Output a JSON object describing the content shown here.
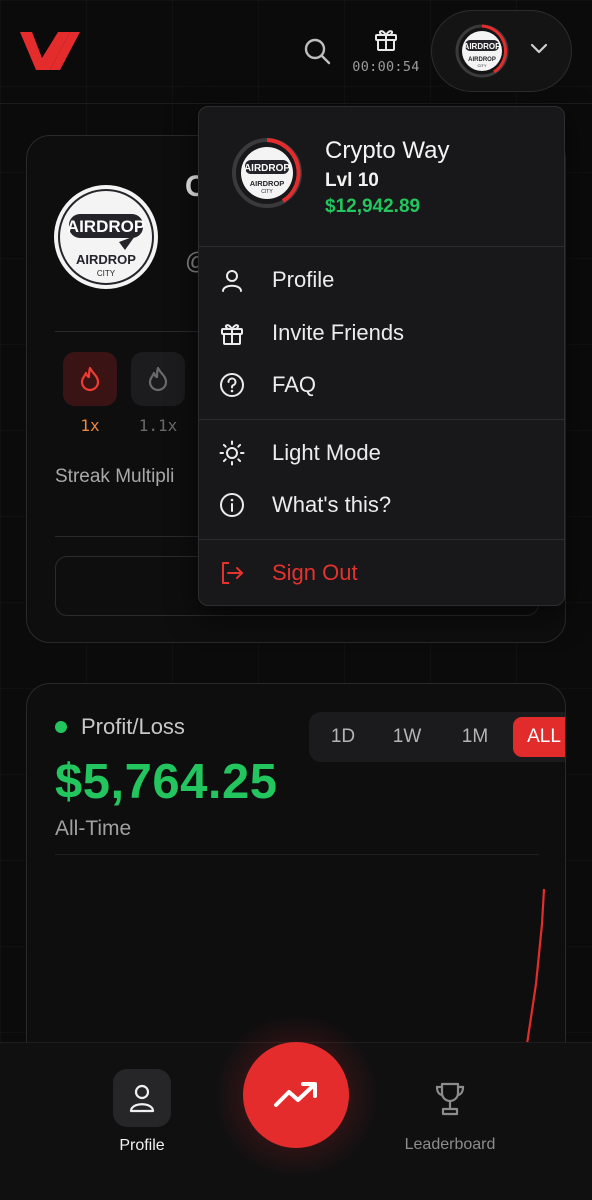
{
  "header": {
    "logo_icon": "brand-logo-icon",
    "search_icon": "search-icon",
    "gift_icon": "gift-icon",
    "timer": "00:00:54",
    "avatar_text": {
      "top": "AIRDROP",
      "bottom": "AIRDROP",
      "city": "CITY"
    }
  },
  "profile_card": {
    "name_peek": "C",
    "handle_peek": "@",
    "avatar_text": {
      "top": "AIRDROP",
      "bottom": "AIRDROP",
      "city": "CITY"
    },
    "multipliers": [
      {
        "label": "1x",
        "active": true
      },
      {
        "label": "1.1x",
        "active": false
      }
    ],
    "streak_label": "Streak Multipli"
  },
  "pnl": {
    "title": "Profit/Loss",
    "value": "$5,764.25",
    "subtitle": "All-Time",
    "ranges": [
      "1D",
      "1W",
      "1M",
      "ALL"
    ],
    "active_range": "ALL"
  },
  "dropdown": {
    "name": "Crypto Way",
    "level": "Lvl 10",
    "balance": "$12,942.89",
    "level_progress": 0.45,
    "avatar_text": {
      "top": "AIRDROP",
      "bottom": "AIRDROP",
      "city": "CITY"
    },
    "items": [
      {
        "label": "Profile",
        "icon": "user-icon"
      },
      {
        "label": "Invite Friends",
        "icon": "gift-icon"
      },
      {
        "label": "FAQ",
        "icon": "question-circle-icon"
      },
      {
        "label": "Light Mode",
        "icon": "sun-icon"
      },
      {
        "label": "What's this?",
        "icon": "info-circle-icon"
      },
      {
        "label": "Sign Out",
        "icon": "sign-out-icon"
      }
    ]
  },
  "bottom_nav": {
    "profile_label": "Profile",
    "leaderboard_label": "Leaderboard",
    "fab_icon": "trending-up-icon"
  },
  "colors": {
    "accent": "#e42c2c",
    "profit": "#22c55e",
    "background": "#0b0b0c"
  }
}
